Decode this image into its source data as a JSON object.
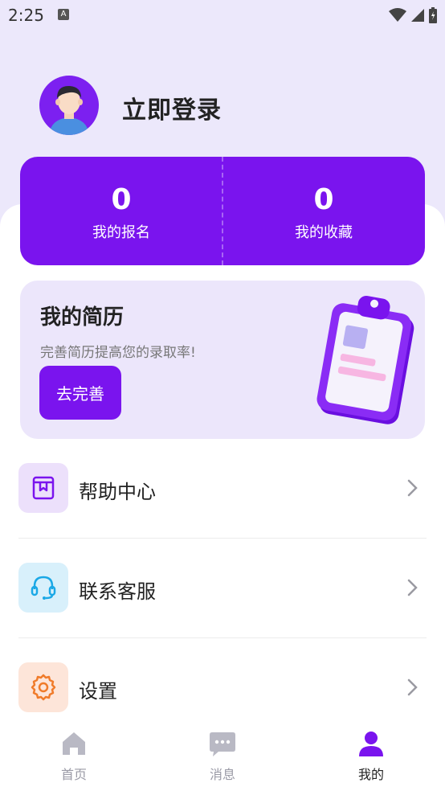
{
  "status_bar": {
    "time": "2:25"
  },
  "profile": {
    "login_text": "立即登录"
  },
  "stats": [
    {
      "count": "0",
      "label": "我的报名"
    },
    {
      "count": "0",
      "label": "我的收藏"
    }
  ],
  "resume": {
    "title": "我的简历",
    "subtitle": "完善简历提高您的录取率!",
    "button_label": "去完善"
  },
  "menu": [
    {
      "label": "帮助中心",
      "icon": "help-book-icon",
      "icon_bg": "#ece0fb",
      "icon_color": "#7a14ee"
    },
    {
      "label": "联系客服",
      "icon": "headset-icon",
      "icon_bg": "#d8f0fb",
      "icon_color": "#1aa8e6"
    },
    {
      "label": "设置",
      "icon": "gear-icon",
      "icon_bg": "#fde5d9",
      "icon_color": "#f07b2a"
    }
  ],
  "bottom_nav": {
    "items": [
      {
        "label": "首页",
        "icon": "home-icon",
        "active": false
      },
      {
        "label": "消息",
        "icon": "message-icon",
        "active": false
      },
      {
        "label": "我的",
        "icon": "user-icon",
        "active": true
      }
    ]
  },
  "colors": {
    "accent": "#7a14ee",
    "nav_inactive": "#b9b9c4",
    "nav_active": "#7a14ee"
  }
}
